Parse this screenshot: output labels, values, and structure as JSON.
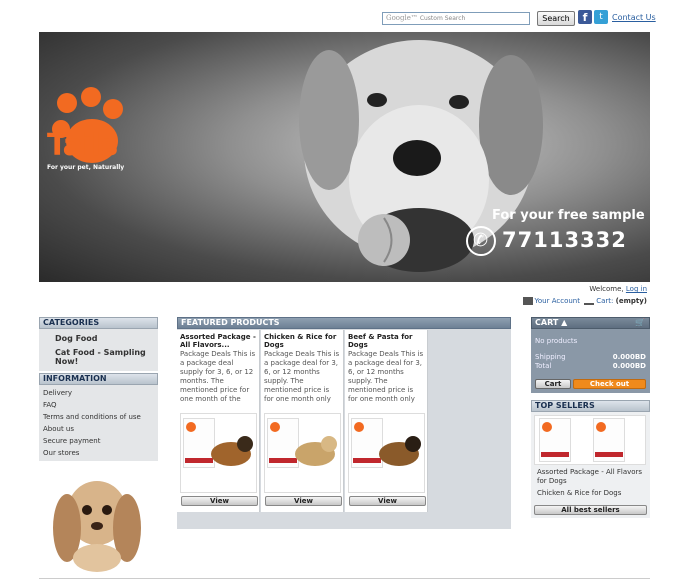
{
  "header": {
    "search_placeholder": "Custom Search",
    "google_label": "Google™",
    "search_button": "Search",
    "contact_link": "Contact Us"
  },
  "banner": {
    "brand": "Tails",
    "slogan": "For your pet, Naturally",
    "sample_text": "For your free sample",
    "phone": "77113332"
  },
  "account": {
    "welcome": "Welcome,",
    "login": "Log in",
    "your_account": "Your Account",
    "cart_label": "Cart:",
    "cart_status": "(empty)"
  },
  "categories": {
    "title": "CATEGORIES",
    "items": [
      "Dog Food",
      "Cat Food - Sampling Now!"
    ]
  },
  "information": {
    "title": "INFORMATION",
    "items": [
      "Delivery",
      "FAQ",
      "Terms and conditions of use",
      "About us",
      "Secure payment",
      "Our stores"
    ]
  },
  "featured": {
    "title": "FEATURED PRODUCTS",
    "products": [
      {
        "name": "Assorted Package - All Flavors...",
        "desc": "Package Deals  This is a package deal supply for 3, 6, or 12 months. The mentioned price for one month of the",
        "view": "View",
        "label_color": "#c0272d"
      },
      {
        "name": "Chicken & Rice for Dogs",
        "desc": "Package Deals  This is a package deal for 3, 6, or 12 months supply. The mentioned price is for one month only",
        "view": "View",
        "label_color": "#c0272d"
      },
      {
        "name": "Beef & Pasta for Dogs",
        "desc": "Package Deals  This is a package deal for 3, 6, or 12 months supply. The mentioned price is for one month only",
        "view": "View",
        "label_color": "#c0272d"
      }
    ]
  },
  "cart": {
    "title": "CART",
    "no_products": "No products",
    "shipping_label": "Shipping",
    "shipping_value": "0.000BD",
    "total_label": "Total",
    "total_value": "0.000BD",
    "cart_button": "Cart",
    "checkout_button": "Check out"
  },
  "top_sellers": {
    "title": "TOP SELLERS",
    "items": [
      "Assorted Package - All Flavors for Dogs",
      "Chicken & Rice for Dogs"
    ],
    "all_button": "All best sellers"
  },
  "colors": {
    "brand_orange": "#f26a21",
    "link_blue": "#2a5fa0",
    "checkout_orange": "#f08a1c"
  }
}
